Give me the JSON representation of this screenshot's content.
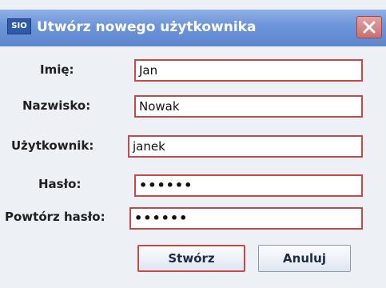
{
  "window": {
    "title": "Utwórz nowego użytkownika",
    "app_icon_text": "SIO"
  },
  "form": {
    "first_name": {
      "label": "Imię:",
      "value": "Jan"
    },
    "last_name": {
      "label": "Nazwisko:",
      "value": "Nowak"
    },
    "username": {
      "label": "Użytkownik:",
      "value": "janek"
    },
    "password": {
      "label": "Hasło:",
      "value": "••••••"
    },
    "password_confirm": {
      "label": "Powtórz hasło:",
      "value": "••••••"
    }
  },
  "buttons": {
    "create_label": "Stwórz",
    "cancel_label": "Anuluj"
  },
  "colors": {
    "title_bar": "#6d94d8",
    "field_border": "#c84848",
    "background": "#edf0f5"
  }
}
